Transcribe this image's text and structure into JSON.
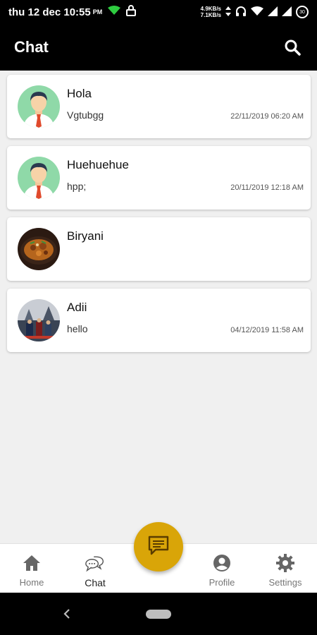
{
  "status_bar": {
    "time": "thu 12 dec 10:55",
    "ampm": "PM",
    "net_up": "4.9KB/s",
    "net_down": "7.1KB/s",
    "battery": "30"
  },
  "app_bar": {
    "title": "Chat",
    "search_icon": "search-icon"
  },
  "chats": [
    {
      "name": "Hola",
      "message": "Vgtubgg",
      "time": "22/11/2019 06:20 AM",
      "avatar": "person-avatar"
    },
    {
      "name": "Huehuehue",
      "message": "hpp;",
      "time": "20/11/2019 12:18 AM",
      "avatar": "person-avatar"
    },
    {
      "name": "Biryani",
      "message": "",
      "time": "",
      "avatar": "food-photo"
    },
    {
      "name": "Adii",
      "message": "hello",
      "time": "04/12/2019 11:58 AM",
      "avatar": "game-photo"
    }
  ],
  "bottom_nav": {
    "items": [
      {
        "label": "Home",
        "icon": "home-icon"
      },
      {
        "label": "Chat",
        "icon": "chat-bubbles-icon"
      },
      {
        "label": "Profile",
        "icon": "profile-icon"
      },
      {
        "label": "Settings",
        "icon": "gear-icon"
      }
    ],
    "active": "Chat"
  },
  "fab": {
    "icon": "message-icon",
    "color": "#d9a508"
  },
  "colors": {
    "app_bar": "#000000",
    "background": "#f0f0f0",
    "accent": "#d9a508"
  }
}
